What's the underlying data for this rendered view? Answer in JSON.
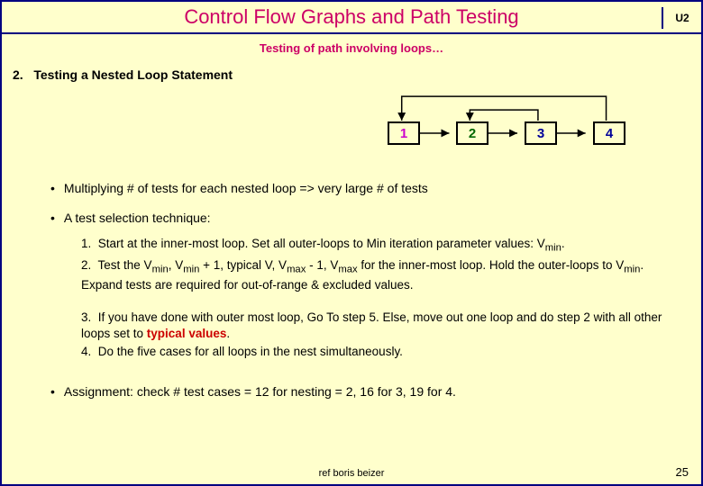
{
  "header": {
    "title": "Control Flow Graphs and Path Testing",
    "unit": "U2"
  },
  "subtitle": "Testing of path involving loops…",
  "section": {
    "number": "2.",
    "heading": "Testing a Nested Loop Statement"
  },
  "nodes": {
    "n1": "1",
    "n2": "2",
    "n3": "3",
    "n4": "4"
  },
  "bullets": {
    "b1": "Multiplying # of tests for each nested loop => very large # of tests",
    "b2": "A test selection technique:",
    "b3_pre": "Assignment:   check # test cases = 12 for nesting = 2,   16 for 3, 19 for 4."
  },
  "steps": {
    "s1_a": "Start at the inner-most loop. Set all outer-loops to Min iteration parameter values: V",
    "s1_sub": "min",
    "s1_end": ".",
    "s2_a": "Test the V",
    "s2_b": ", V",
    "s2_c": " + 1, typical V, V",
    "s2_d": " - 1, V",
    "s2_e": " for the inner-most loop. Hold the outer-loops to V",
    "s2_f": ". Expand tests are required for out-of-range & excluded values.",
    "s2_sub_min": "min",
    "s2_sub_max": "max",
    "s3": "If you have done with outer most loop, Go To step 5.   Else, move out one loop and do step 2 with all other loops set to ",
    "s3_typ": "typical values",
    "s3_end": ".",
    "s4": "Do the five cases for all loops in the nest simultaneously."
  },
  "footer": {
    "ref": "ref boris beizer",
    "page": "25"
  }
}
